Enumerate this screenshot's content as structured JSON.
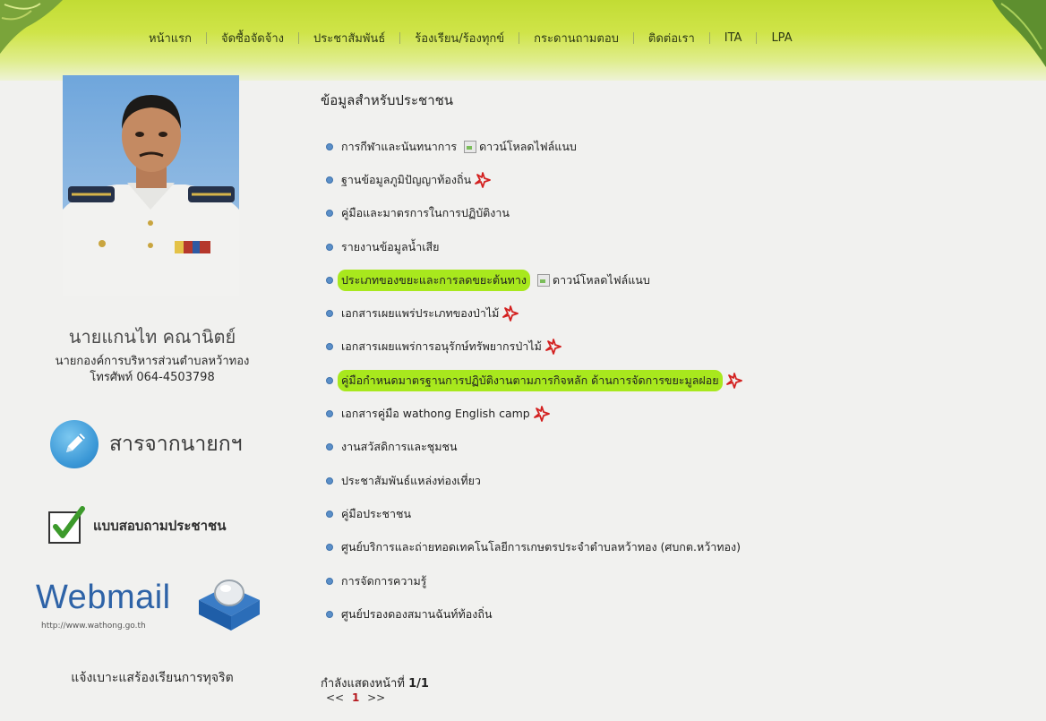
{
  "nav": {
    "items": [
      "หน้าแรก",
      "จัดซื้อจัดจ้าง",
      "ประชาสัมพันธ์",
      "ร้องเรียน/ร้องทุกข์",
      "กระดานถามตอบ",
      "ติดต่อเรา",
      "ITA",
      "LPA"
    ]
  },
  "sidebar": {
    "mayor_name": "นายแกนไท คณานิตย์",
    "mayor_title": "นายกองค์การบริหารส่วนตำบลหว้าทอง",
    "mayor_phone": "โทรศัพท์ 064-4503798",
    "message_label": "สารจากนายกฯ",
    "survey_label": "แบบสอบถามประชาชน",
    "webmail_word": "Webmail",
    "webmail_url": "http://www.wathong.go.th",
    "report_label": "แจ้งเบาะแสร้องเรียนการทุจริต"
  },
  "main": {
    "title": "ข้อมูลสำหรับประชาชน",
    "items": [
      {
        "label": "การกีฬาและนันทนาการ",
        "attachment": "ดาวน์โหลดไฟล์แนบ"
      },
      {
        "label": "ฐานข้อมูลภูมิปัญญาท้องถิ่น"
      },
      {
        "label": "คู่มือและมาตรการในการปฏิบัติงาน"
      },
      {
        "label": "รายงานข้อมูลน้ำเสีย"
      },
      {
        "label": "ประเภทของขยะและการลดขยะต้นทาง",
        "attachment": "ดาวน์โหลดไฟล์แนบ"
      },
      {
        "label": "เอกสารเผยแพร่ประเภทของป่าไม้"
      },
      {
        "label": "เอกสารเผยแพร่การอนุรักษ์ทรัพยากรป่าไม้"
      },
      {
        "label": "คู่มือกำหนดมาตรฐานการปฏิบัติงานตามภารกิจหลัก ด้านการจัดการขยะมูลฝอย"
      },
      {
        "label": "เอกสารคู่มือ wathong English camp"
      },
      {
        "label": "งานสวัสดิการและชุมชน"
      },
      {
        "label": "ประชาสัมพันธ์แหล่งท่องเที่ยว"
      },
      {
        "label": "คู่มือประชาชน"
      },
      {
        "label": "ศูนย์บริการและถ่ายทอดเทคโนโลยีการเกษตรประจำตำบลหว้าทอง (ศบกต.หว้าทอง)"
      },
      {
        "label": "การจัดการความรู้"
      },
      {
        "label": "ศูนย์ปรองดองสมานฉันท์ท้องถิ่น"
      }
    ],
    "pager_text": "กำลังแสดงหน้าที่",
    "pager_value": "1/1",
    "pager_prev": "<<",
    "pager_current": "1",
    "pager_next": ">>"
  }
}
